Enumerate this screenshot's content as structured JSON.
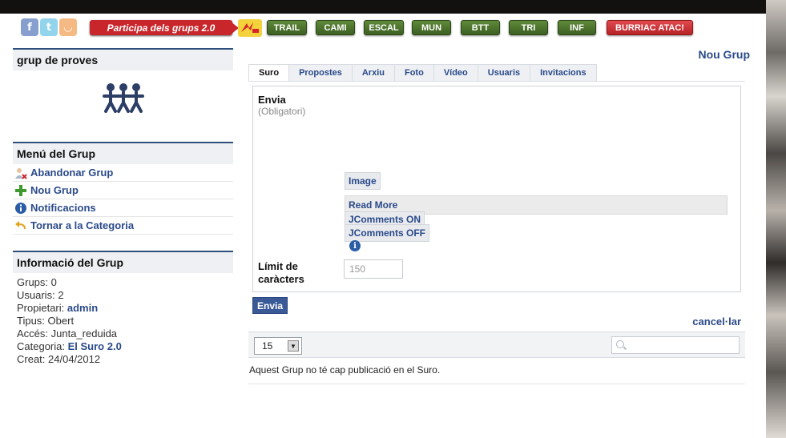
{
  "social": {
    "facebook_icon": "facebook-icon",
    "twitter_icon": "twitter-icon",
    "rss_icon": "rss-icon",
    "facebook_glyph": "f",
    "twitter_glyph": "t",
    "rss_glyph": "◡"
  },
  "topnav": {
    "participa_label": "Participa dels grups 2.0",
    "items": [
      "TRAIL",
      "CAMI",
      "ESCAL",
      "MUN",
      "BTT",
      "TRI",
      "INF",
      "BURRIAC ATAC!"
    ]
  },
  "sidebar": {
    "group_title": "grup de proves",
    "menu_title": "Menú del Grup",
    "menu_items": [
      {
        "label": "Abandonar Grup",
        "icon": "user-remove-icon"
      },
      {
        "label": "Nou Grup",
        "icon": "plus-icon"
      },
      {
        "label": "Notificacions",
        "icon": "info-icon"
      },
      {
        "label": "Tornar a la Categoria",
        "icon": "back-arrow-icon"
      }
    ],
    "info_title": "Informació del Grup",
    "info": {
      "grups_label": "Grups:",
      "grups_value": "0",
      "usuaris_label": "Usuaris:",
      "usuaris_value": "2",
      "propietari_label": "Propietari:",
      "propietari_value": "admin",
      "tipus_label": "Tipus:",
      "tipus_value": "Obert",
      "acces_label": "Accés:",
      "acces_value": "Junta_reduida",
      "categoria_label": "Categoria:",
      "categoria_value": "El Suro 2.0",
      "creat_label": "Creat:",
      "creat_value": "24/04/2012"
    }
  },
  "main": {
    "new_group_link": "Nou Grup",
    "tabs": [
      "Suro",
      "Propostes",
      "Arxiu",
      "Foto",
      "Vídeo",
      "Usuaris",
      "Invitacions"
    ],
    "active_tab": "Suro",
    "form": {
      "envia_label": "Envia",
      "required_hint": "(Obligatori)",
      "image_button": "Image",
      "readmore_button": "Read More",
      "jcomments_on": "JComments ON",
      "jcomments_off": "JComments OFF",
      "limit_label": "Límit de caràcters",
      "limit_placeholder": "150"
    },
    "submit_button": "Envia",
    "cancel_link": "cancel·lar",
    "page_size": "15",
    "empty_message": "Aquest Grup no té cap publicació en el Suro."
  }
}
